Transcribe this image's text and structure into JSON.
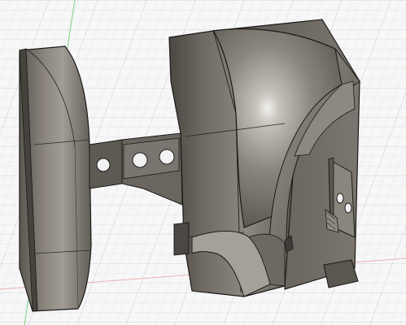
{
  "window": {
    "title": ""
  },
  "viewport": {
    "background": "#f7f7f8",
    "grid_minor_color": "#e3e3e6",
    "grid_major_color": "#cfd0d4",
    "axis_y_color": "#7fd07f",
    "axis_x_color": "#e88c8c"
  },
  "model": {
    "body_color": "#6f6a63",
    "highlight_color": "#cfccc6",
    "edge_color": "#1b1a18",
    "parts": [
      "left-shell",
      "center-bracket",
      "main-housing",
      "right-mount-plate"
    ]
  }
}
